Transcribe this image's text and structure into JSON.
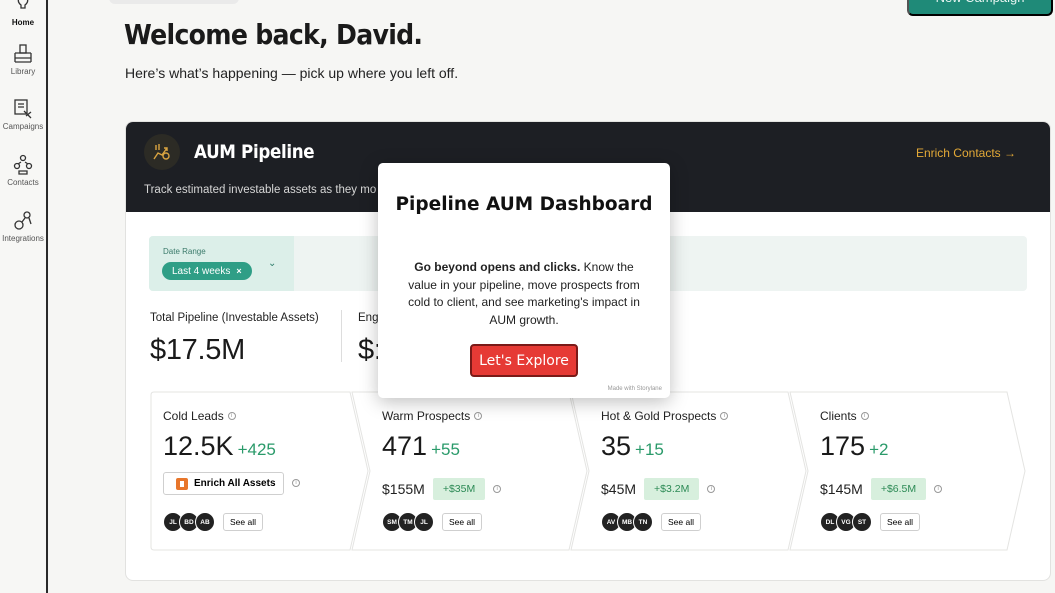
{
  "sidebar": {
    "items": [
      {
        "label": "Home",
        "icon": "lightbulb-icon",
        "active": true
      },
      {
        "label": "Library",
        "icon": "library-icon",
        "active": false
      },
      {
        "label": "Campaigns",
        "icon": "campaigns-icon",
        "active": false
      },
      {
        "label": "Contacts",
        "icon": "contacts-icon",
        "active": false
      },
      {
        "label": "Integrations",
        "icon": "integrations-icon",
        "active": false
      }
    ]
  },
  "header": {
    "new_campaign_label": "New Campaign",
    "welcome": "Welcome back, David.",
    "subtitle": "Here’s what’s happening — pick up where you left off."
  },
  "pipeline": {
    "title": "AUM Pipeline",
    "description": "Track estimated investable assets as they mo",
    "enrich_link": "Enrich Contacts →",
    "filter": {
      "label": "Date Range",
      "chip": "Last 4 weeks",
      "chip_close": "×",
      "chevron": "⌄"
    },
    "total_label": "Total Pipeline (Investable Assets)",
    "total_value": "$17.5M",
    "second_label": "Eng",
    "second_value": "$:",
    "stages": [
      {
        "name": "Cold Leads",
        "count": "12.5K",
        "delta": "+425",
        "enrich_button": "Enrich All Assets",
        "avatars": [
          "JL",
          "BD",
          "AB"
        ],
        "see_all": "See all"
      },
      {
        "name": "Warm Prospects",
        "count": "471",
        "delta": "+55",
        "amount": "$155M",
        "amount_delta": "+$35M",
        "avatars": [
          "SM",
          "TM",
          "JL"
        ],
        "see_all": "See all"
      },
      {
        "name": "Hot & Gold Prospects",
        "count": "35",
        "delta": "+15",
        "amount": "$45M",
        "amount_delta": "+$3.2M",
        "avatars": [
          "AV",
          "MB",
          "TN"
        ],
        "see_all": "See all"
      },
      {
        "name": "Clients",
        "count": "175",
        "delta": "+2",
        "amount": "$145M",
        "amount_delta": "+$6.5M",
        "avatars": [
          "DL",
          "VG",
          "ST"
        ],
        "see_all": "See all"
      }
    ]
  },
  "modal": {
    "title": "Pipeline AUM Dashboard",
    "body_bold": "Go beyond opens and clicks.",
    "body_rest": " Know the value in your pipeline, move prospects from cold to client, and see marketing's impact in AUM growth.",
    "button": "Let's Explore",
    "made_with": "Made with Storylane"
  },
  "colors": {
    "accent_teal": "#1f8a78",
    "chip_teal": "#2f9e86",
    "header_dark": "#1d1f24",
    "gold": "#e3a937",
    "explore_red": "#e63a35",
    "delta_green": "#2a9a6a"
  }
}
